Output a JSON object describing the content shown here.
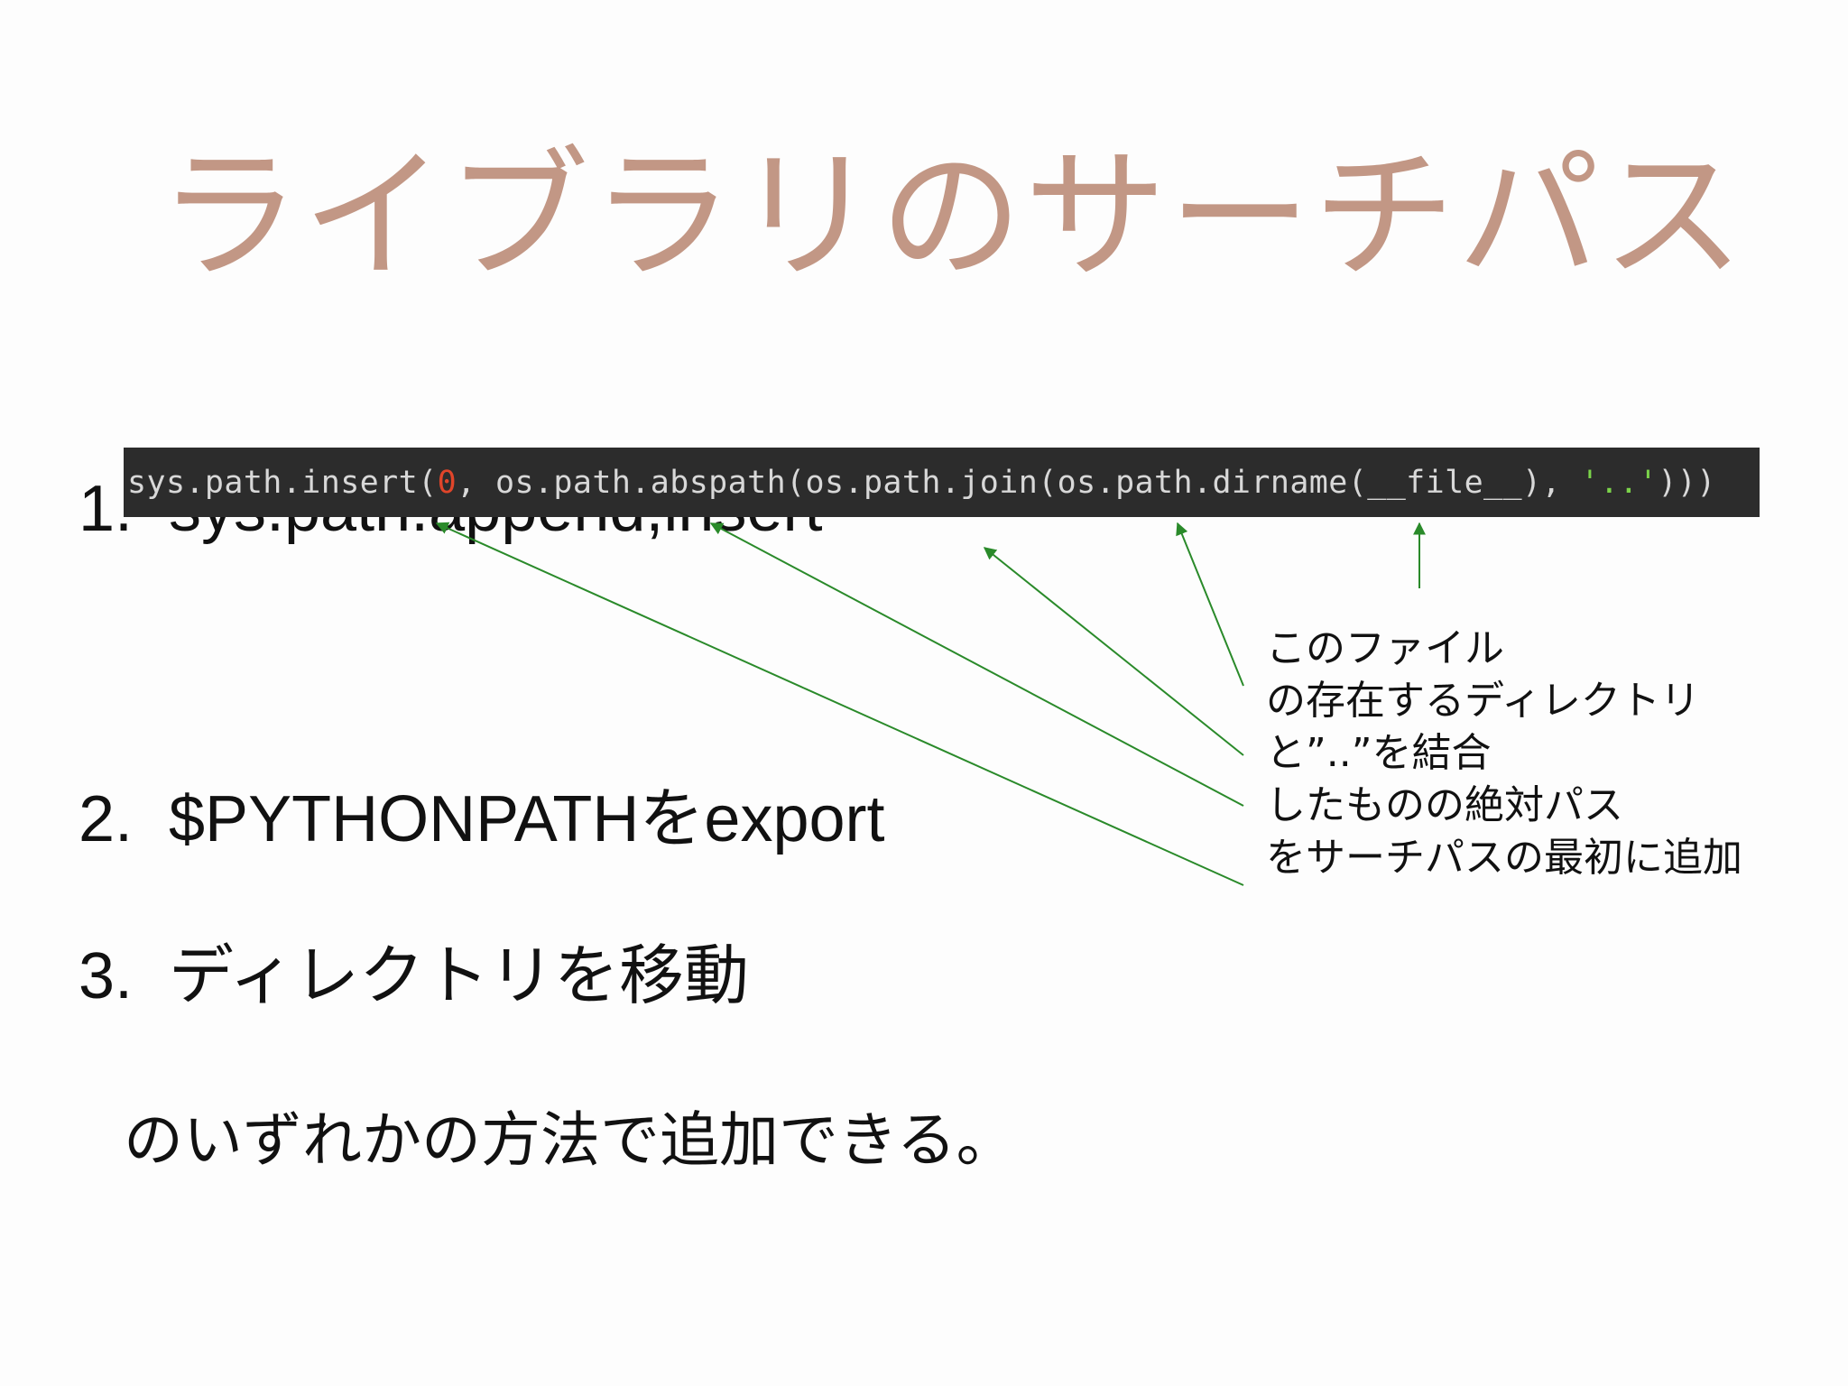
{
  "slide": {
    "title": "ライブラリのサーチパス",
    "items": [
      {
        "number": "1.",
        "text": "sys.path.append,insert"
      },
      {
        "number": "2.",
        "text": "$PYTHONPATHをexport"
      },
      {
        "number": "3.",
        "text": "ディレクトリを移動"
      }
    ],
    "conclusion": "のいずれかの方法で追加できる。",
    "code": {
      "prefix": "sys.path.insert(",
      "zero": "0",
      "middle": ", os.path.abspath(os.path.join(os.path.dirname(__file__), ",
      "string": "'..'",
      "suffix": ")))"
    },
    "annotation_lines": [
      "このファイル",
      "の存在するディレクトリ",
      "と”..”を結合",
      "したものの絶対パス",
      "をサーチパスの最初に追加"
    ],
    "colors": {
      "title": "#c29785",
      "code_background": "#2c2c2c",
      "code_text": "#d8d8d8",
      "code_zero": "#e0452a",
      "code_string": "#7bd34a",
      "arrow": "#2a8a2a"
    }
  }
}
